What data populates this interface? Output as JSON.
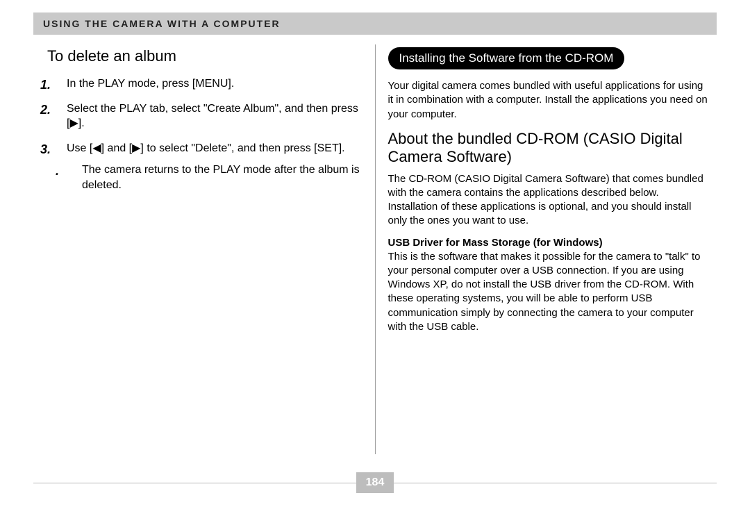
{
  "header": {
    "chapter_title": "USING THE CAMERA WITH A COMPUTER"
  },
  "left": {
    "title": "To delete an album",
    "steps": [
      {
        "num": "1",
        "html": "In the PLAY mode, press [MENU]."
      },
      {
        "num": "2",
        "html": "Select the PLAY tab, select \"Create Album\", and then press [▶]."
      },
      {
        "num": "3",
        "html": "Use [◀] and [▶] to select \"Delete\", and then press [SET].",
        "sub": [
          "The camera returns to the PLAY mode after the album is deleted."
        ]
      }
    ]
  },
  "right": {
    "pill": "Installing the Software from the CD-ROM",
    "intro": "Your digital camera comes bundled with useful applications for using it in combination with a computer. Install the applications you need on your computer.",
    "about_title": "About the bundled CD-ROM (CASIO Digital Camera Software)",
    "about_body": "The CD-ROM (CASIO Digital Camera Software) that comes bundled with the camera contains the applications described below. Installation of these applications is optional, and you should install only the ones you want to use.",
    "driver_head": "USB Driver for Mass Storage (for Windows)",
    "driver_body": "This is the software that makes it possible for the camera to \"talk\" to your personal computer over a USB connection. If you are using Windows XP, do not install the USB driver from the CD-ROM. With these operating systems, you will be able to perform USB communication simply by connecting the camera to your computer with the USB cable."
  },
  "footer": {
    "page_number": "184"
  }
}
